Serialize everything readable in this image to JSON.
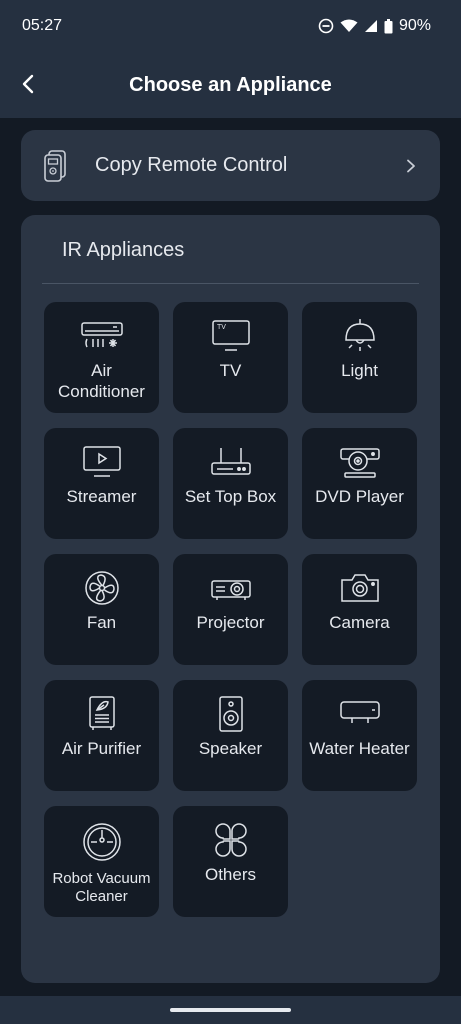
{
  "status": {
    "time": "05:27",
    "battery": "90%"
  },
  "header": {
    "title": "Choose an Appliance"
  },
  "copy_remote": {
    "label": "Copy Remote Control"
  },
  "ir": {
    "title": "IR Appliances",
    "items": [
      {
        "label": "Air Conditioner",
        "icon": "air-conditioner-icon"
      },
      {
        "label": "TV",
        "icon": "tv-icon"
      },
      {
        "label": "Light",
        "icon": "light-icon"
      },
      {
        "label": "Streamer",
        "icon": "streamer-icon"
      },
      {
        "label": "Set Top Box",
        "icon": "set-top-box-icon"
      },
      {
        "label": "DVD Player",
        "icon": "dvd-player-icon"
      },
      {
        "label": "Fan",
        "icon": "fan-icon"
      },
      {
        "label": "Projector",
        "icon": "projector-icon"
      },
      {
        "label": "Camera",
        "icon": "camera-icon"
      },
      {
        "label": "Air Purifier",
        "icon": "air-purifier-icon"
      },
      {
        "label": "Speaker",
        "icon": "speaker-icon"
      },
      {
        "label": "Water Heater",
        "icon": "water-heater-icon"
      },
      {
        "label": "Robot Vacuum Cleaner",
        "icon": "robot-vacuum-icon"
      },
      {
        "label": "Others",
        "icon": "others-icon"
      }
    ]
  },
  "colors": {
    "background": "#131a24",
    "bar": "#253040",
    "card": "#2b3544",
    "tile": "#141b25",
    "text": "#e6e9ee"
  }
}
